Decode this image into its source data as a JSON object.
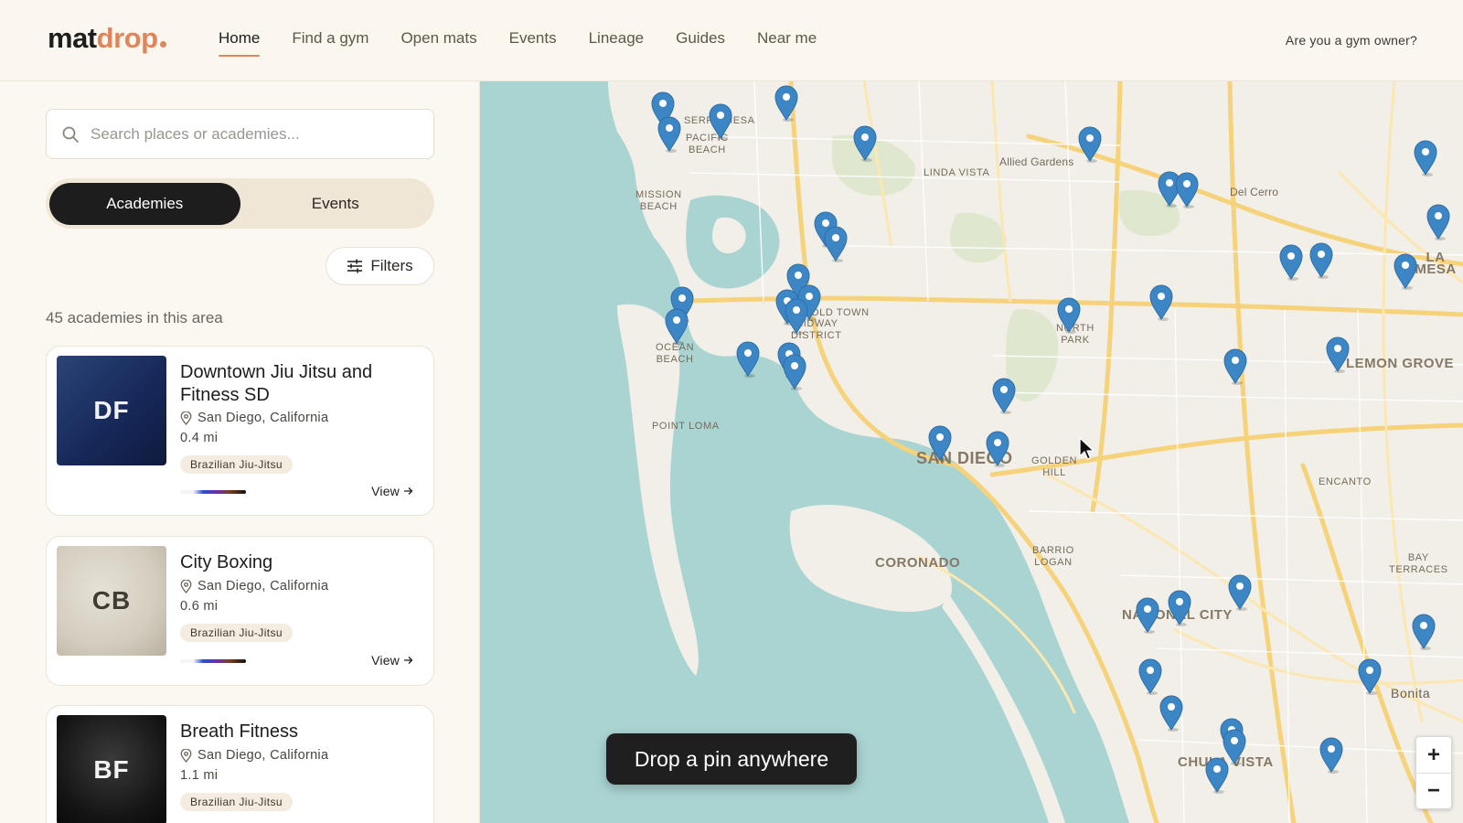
{
  "brand": {
    "part1": "mat",
    "part2": "drop",
    "accent": "#e0845a"
  },
  "nav": {
    "items": [
      "Home",
      "Find a gym",
      "Open mats",
      "Events",
      "Lineage",
      "Guides",
      "Near me"
    ],
    "active": "Home"
  },
  "header": {
    "owner_link": "Are you a gym owner?"
  },
  "sidebar": {
    "search_placeholder": "Search places or academies...",
    "segment": {
      "academies": "Academies",
      "events": "Events",
      "active": "Academies"
    },
    "filters_label": "Filters",
    "count_text": "45 academies in this area",
    "cards": [
      {
        "initials": "DF",
        "name": "Downtown Jiu Jitsu and Fitness SD",
        "location": "San Diego, California",
        "distance": "0.4 mi",
        "tag": "Brazilian Jiu-Jitsu",
        "view_label": "View"
      },
      {
        "initials": "CB",
        "name": "City Boxing",
        "location": "San Diego, California",
        "distance": "0.6 mi",
        "tag": "Brazilian Jiu-Jitsu",
        "view_label": "View"
      },
      {
        "initials": "BF",
        "name": "Breath Fitness",
        "location": "San Diego, California",
        "distance": "1.1 mi",
        "tag": "Brazilian Jiu-Jitsu",
        "view_label": "View"
      }
    ]
  },
  "map": {
    "hint": "Drop a pin anywhere",
    "zoom_in": "+",
    "zoom_out": "−",
    "pin_color": "#3d86c6",
    "labels": {
      "serra_mesa": "SERRA MESA",
      "allied_gardens": "Allied Gardens",
      "del_cerro": "Del Cerro",
      "linda_vista": "LINDA VISTA",
      "pacific_beach": "PACIFIC\nBEACH",
      "mission_beach": "MISSION\nBEACH",
      "old_town": "OLD TOWN",
      "midway": "MIDWAY\nDISTRICT",
      "ocean_beach": "OCEAN\nBEACH",
      "point_loma": "POINT LOMA",
      "north_park": "NORTH\nPARK",
      "san_diego": "SAN DIEGO",
      "golden_hill": "GOLDEN\nHILL",
      "lemon_grove": "LEMON GROVE",
      "la_mesa": "LA MESA",
      "encanto": "ENCANTO",
      "coronado": "CORONADO",
      "barrio_logan": "BARRIO\nLOGAN",
      "national_city": "NATIONAL CITY",
      "bay_terraces": "BAY\nTERRACES",
      "bonita": "Bonita",
      "chula_vista": "CHULA VISTA"
    }
  }
}
